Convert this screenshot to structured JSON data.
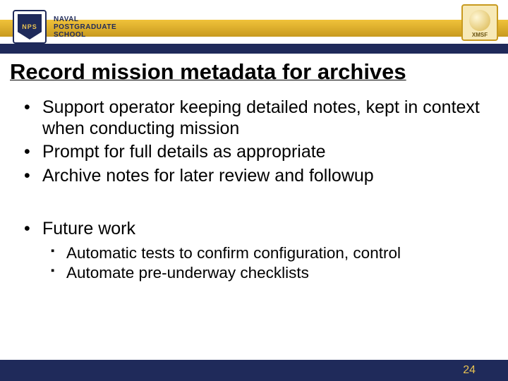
{
  "header": {
    "shield_text": "NPS",
    "org_line1": "NAVAL",
    "org_line2": "POSTGRADUATE",
    "org_line3": "SCHOOL",
    "corner_logo_label": "XMSF"
  },
  "title": "Record mission metadata for archives",
  "bullets": [
    "Support operator keeping detailed notes, kept in context when conducting mission",
    "Prompt for full details as appropriate",
    "Archive notes for later review and followup"
  ],
  "future": {
    "heading": "Future work",
    "items": [
      "Automatic tests to confirm configuration, control",
      "Automate pre-underway checklists"
    ]
  },
  "page_number": "24"
}
